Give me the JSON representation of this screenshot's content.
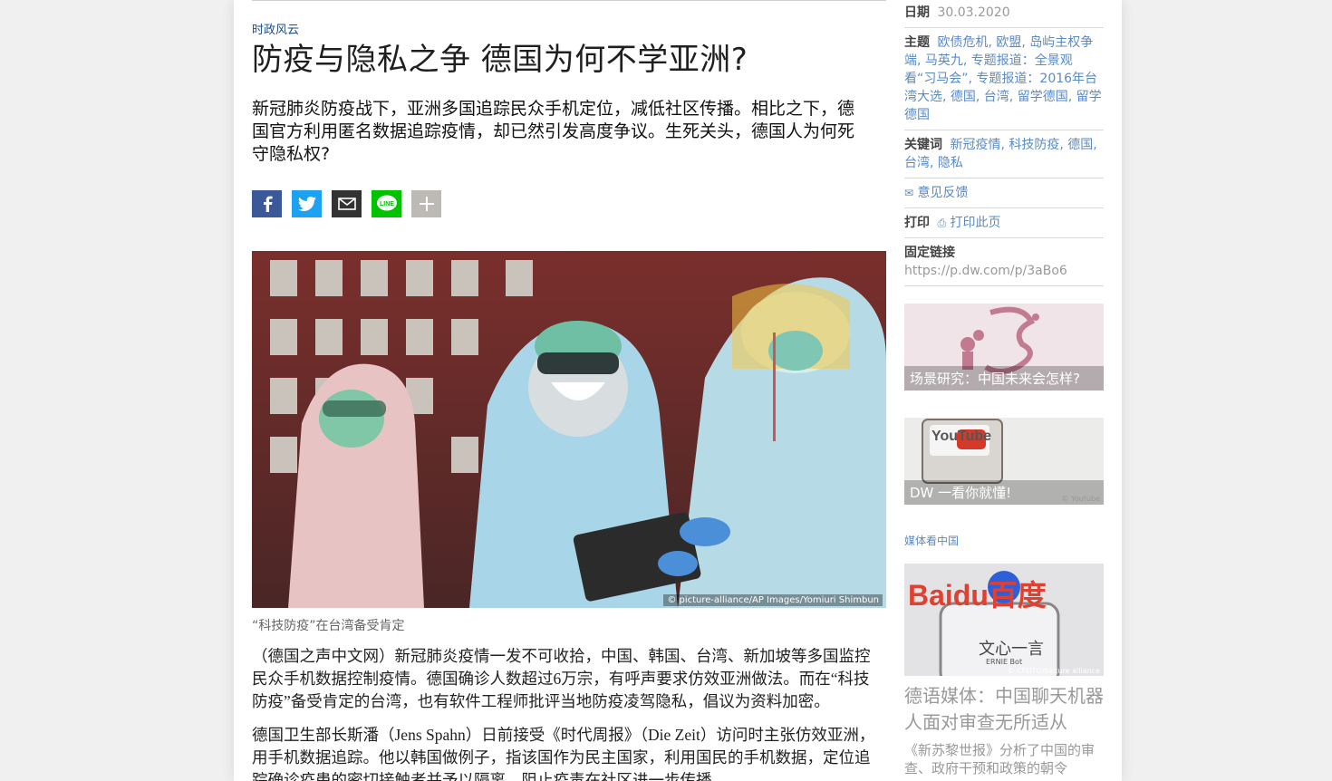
{
  "article": {
    "kicker": "时政风云",
    "headline": "防疫与隐私之争 德国为何不学亚洲?",
    "lead": "新冠肺炎防疫战下，亚洲多国追踪民众手机定位，减低社区传播。相比之下，德国官方利用匿名数据追踪疫情，却已然引发高度争议。生死关头，德国人为何死守隐私权?",
    "image_credit": "© picture-alliance/AP Images/Yomiuri Shimbun",
    "image_caption": "“科技防疫”在台湾备受肯定",
    "paragraphs": [
      "（德国之声中文网）新冠肺炎疫情一发不可收拾，中国、韩国、台湾、新加坡等多国监控民众手机数据控制疫情。德国确诊人数超过6万宗，有呼声要求仿效亚洲做法。而在“科技防疫”备受肯定的台湾，也有软件工程师批评当地防疫凌驾隐私，倡议为资料加密。",
      "德国卫生部长斯潘（Jens Spahn）日前接受《时代周报》（Die Zeit）访问时主张仿效亚洲，用手机数据追踪。他以韩国做例子，指该国作为民主国家，利用国民的手机数据，定位追踪确诊疫患的密切接触者并予以隔离，阻止疫毒在社区进一步传播。"
    ]
  },
  "share": {
    "icons": [
      "facebook-icon",
      "twitter-icon",
      "email-icon",
      "line-icon",
      "plus-icon"
    ]
  },
  "sidebar": {
    "date_label": "日期",
    "date_value": "30.03.2020",
    "topics_label": "主题",
    "topics_value": "欧债危机, 欧盟, 岛屿主权争端, 马英九, 专题报道：全景观看“习马会”, 专题报道：2016年台湾大选, 德国, 台湾, 留学德国, 留学德国",
    "keywords_label": "关键词",
    "keywords_value": "新冠疫情, 科技防疫, 德国, 台湾, 隐私",
    "feedback_label": "意见反馈",
    "print_label": "打印",
    "print_link": "打印此页",
    "permalink_label": "固定链接",
    "permalink_value": "https://p.dw.com/p/3aBo6",
    "tile1_label": "场景研究：中国未来会怎样?",
    "tile2_label": "DW 一看你就懂!",
    "tile2_credit": "© Youtube",
    "tile2_brand": "YouTube",
    "section_label": "媒体看中国",
    "tile3_brand": "Baidu百度",
    "tile3_product": "文心一言",
    "tile3_sub": "ERNIE Bot",
    "tile3_credit": "© CFOTO/picture alliance",
    "teaser_title": "德语媒体：中国聊天机器人面对审查无所适从",
    "teaser_text": "《新苏黎世报》分析了中国的审查、政府干预和政策的朝令"
  },
  "colors": {
    "link": "#5a8ac6",
    "kicker": "#1a4e8a",
    "facebook": "#3b5998",
    "twitter": "#1da1f2",
    "line": "#00c300"
  }
}
